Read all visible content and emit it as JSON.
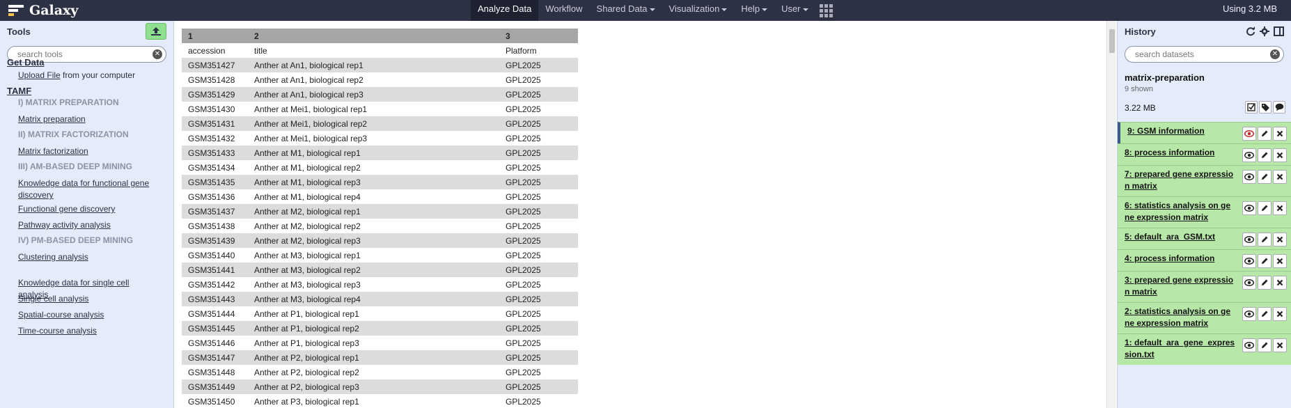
{
  "masthead": {
    "brand": "Galaxy",
    "nav": [
      {
        "label": "Analyze Data",
        "caret": false,
        "active": true
      },
      {
        "label": "Workflow",
        "caret": false,
        "active": false
      },
      {
        "label": "Shared Data",
        "caret": true,
        "active": false
      },
      {
        "label": "Visualization",
        "caret": true,
        "active": false
      },
      {
        "label": "Help",
        "caret": true,
        "active": false
      },
      {
        "label": "User",
        "caret": true,
        "active": false
      }
    ],
    "quota": "Using 3.2 MB"
  },
  "tools": {
    "title": "Tools",
    "search_placeholder": "search tools",
    "get_data": "Get Data",
    "upload_link": "Upload File",
    "upload_suffix": " from your computer",
    "section": "TAMF",
    "items": [
      {
        "kind": "sub",
        "label": "I) MATRIX PREPARATION"
      },
      {
        "kind": "link",
        "label": "Matrix preparation"
      },
      {
        "kind": "sub",
        "label": "II) MATRIX FACTORIZATION"
      },
      {
        "kind": "link",
        "label": "Matrix factorization"
      },
      {
        "kind": "sub",
        "label": "III) AM-BASED DEEP MINING"
      },
      {
        "kind": "link",
        "label": "Knowledge data for functional gene discovery"
      },
      {
        "kind": "link",
        "label": "Functional gene discovery"
      },
      {
        "kind": "link",
        "label": "Pathway activity analysis"
      },
      {
        "kind": "sub",
        "label": "IV) PM-BASED DEEP MINING"
      },
      {
        "kind": "link",
        "label": "Clustering analysis"
      },
      {
        "kind": "link",
        "label": "Knowledge data for single cell analysis"
      },
      {
        "kind": "link",
        "label": "Single cell analysis"
      },
      {
        "kind": "link",
        "label": "Spatial-course analysis"
      },
      {
        "kind": "link",
        "label": "Time-course analysis"
      }
    ]
  },
  "table": {
    "column_numbers": [
      "1",
      "2",
      "3"
    ],
    "column_names": [
      "accession",
      "title",
      "Platform"
    ],
    "rows": [
      [
        "GSM351427",
        "Anther at An1, biological rep1",
        "GPL2025"
      ],
      [
        "GSM351428",
        "Anther at An1, biological rep2",
        "GPL2025"
      ],
      [
        "GSM351429",
        "Anther at An1, biological rep3",
        "GPL2025"
      ],
      [
        "GSM351430",
        "Anther at Mei1, biological rep1",
        "GPL2025"
      ],
      [
        "GSM351431",
        "Anther at Mei1, biological rep2",
        "GPL2025"
      ],
      [
        "GSM351432",
        "Anther at Mei1, biological rep3",
        "GPL2025"
      ],
      [
        "GSM351433",
        "Anther at M1, biological rep1",
        "GPL2025"
      ],
      [
        "GSM351434",
        "Anther at M1, biological rep2",
        "GPL2025"
      ],
      [
        "GSM351435",
        "Anther at M1, biological rep3",
        "GPL2025"
      ],
      [
        "GSM351436",
        "Anther at M1, biological rep4",
        "GPL2025"
      ],
      [
        "GSM351437",
        "Anther at M2, biological rep1",
        "GPL2025"
      ],
      [
        "GSM351438",
        "Anther at M2, biological rep2",
        "GPL2025"
      ],
      [
        "GSM351439",
        "Anther at M2, biological rep3",
        "GPL2025"
      ],
      [
        "GSM351440",
        "Anther at M3, biological rep1",
        "GPL2025"
      ],
      [
        "GSM351441",
        "Anther at M3, biological rep2",
        "GPL2025"
      ],
      [
        "GSM351442",
        "Anther at M3, biological rep3",
        "GPL2025"
      ],
      [
        "GSM351443",
        "Anther at M3, biological rep4",
        "GPL2025"
      ],
      [
        "GSM351444",
        "Anther at P1, biological rep1",
        "GPL2025"
      ],
      [
        "GSM351445",
        "Anther at P1, biological rep2",
        "GPL2025"
      ],
      [
        "GSM351446",
        "Anther at P1, biological rep3",
        "GPL2025"
      ],
      [
        "GSM351447",
        "Anther at P2, biological rep1",
        "GPL2025"
      ],
      [
        "GSM351448",
        "Anther at P2, biological rep2",
        "GPL2025"
      ],
      [
        "GSM351449",
        "Anther at P2, biological rep3",
        "GPL2025"
      ],
      [
        "GSM351450",
        "Anther at P3, biological rep1",
        "GPL2025"
      ]
    ]
  },
  "history": {
    "title": "History",
    "search_placeholder": "search datasets",
    "name": "matrix-preparation",
    "shown": "9 shown",
    "size": "3.22 MB",
    "datasets": [
      {
        "label": "9: GSM information",
        "current": true
      },
      {
        "label": "8: process information",
        "current": false
      },
      {
        "label": "7: prepared gene expression matrix",
        "current": false
      },
      {
        "label": "6: statistics analysis on gene expression matrix",
        "current": false
      },
      {
        "label": "5: default_ara_GSM.txt",
        "current": false
      },
      {
        "label": "4: process information",
        "current": false
      },
      {
        "label": "3: prepared gene expression matrix",
        "current": false
      },
      {
        "label": "2: statistics analysis on gene expression matrix",
        "current": false
      },
      {
        "label": "1: default_ara_gene_expression.txt",
        "current": false
      }
    ]
  },
  "colors": {
    "masthead": "#2c3143",
    "panel_bg": "#e4ebfa",
    "dataset_ok": "#b8e8a8",
    "upload_green": "#8ee08e"
  }
}
